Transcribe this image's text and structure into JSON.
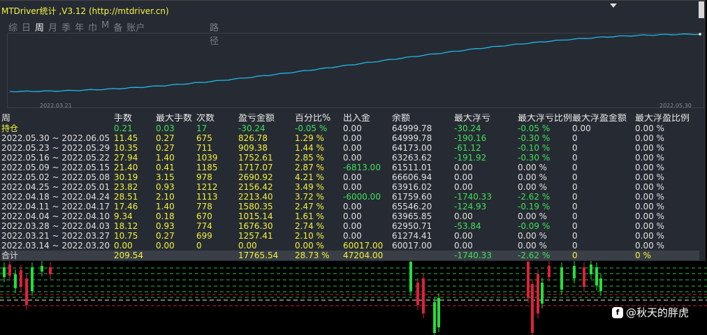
{
  "title": "MTDriver统计 ,V3.12 (http://mtdriver.cn)",
  "tabs": [
    "综",
    "日",
    "周",
    "月",
    "季",
    "年",
    "巾",
    "M",
    "备",
    "账户"
  ],
  "active_tab": "周",
  "path_tab": "路径",
  "equity": {
    "start_date": "2022.03.21",
    "end_date": "2022.05.30",
    "line_color": "#1fb8e8"
  },
  "headers": [
    "周",
    "手数",
    "最大手数",
    "次数",
    "盈亏金额",
    "百分比%",
    "出入金",
    "余额",
    "最大浮亏",
    "最大浮亏比例",
    "最大浮盈金额",
    "最大浮盈比例"
  ],
  "holding": [
    "持仓",
    "0.21",
    "0.03",
    "17",
    "-30.24",
    "-0.05 %",
    "0.00",
    "64999.78",
    "-30.24",
    "-0.05 %",
    "0.00",
    "0.00 %"
  ],
  "rows": [
    [
      "2022.05.30 ~ 2022.06.05",
      "11.45",
      "0.27",
      "675",
      "826.78",
      "1.29 %",
      "0.00",
      "64999.78",
      "-190.16",
      "-0.30 %",
      "0",
      "0.00 %"
    ],
    [
      "2022.05.23 ~ 2022.05.29",
      "10.35",
      "0.27",
      "711",
      "909.38",
      "1.44 %",
      "0.00",
      "64173.00",
      "-61.12",
      "-0.10 %",
      "0",
      "0.00 %"
    ],
    [
      "2022.05.16 ~ 2022.05.22",
      "27.94",
      "1.40",
      "1039",
      "1752.61",
      "2.85 %",
      "0.00",
      "63263.62",
      "-191.92",
      "-0.30 %",
      "0",
      "0.00 %"
    ],
    [
      "2022.05.09 ~ 2022.05.15",
      "21.40",
      "0.41",
      "1185",
      "1717.07",
      "2.87 %",
      "-6813.00",
      "61511.01",
      "0.00",
      "0.00 %",
      "0",
      "0.00 %"
    ],
    [
      "2022.05.02 ~ 2022.05.08",
      "30.19",
      "3.15",
      "978",
      "2690.92",
      "4.21 %",
      "0.00",
      "66606.94",
      "0.00",
      "0.00 %",
      "0",
      "0.00 %"
    ],
    [
      "2022.04.25 ~ 2022.05.01",
      "23.82",
      "0.93",
      "1212",
      "2156.42",
      "3.49 %",
      "0.00",
      "63916.02",
      "0.00",
      "0.00 %",
      "0",
      "0.00 %"
    ],
    [
      "2022.04.18 ~ 2022.04.24",
      "28.51",
      "2.10",
      "1113",
      "2213.40",
      "3.72 %",
      "-6000.00",
      "61759.60",
      "-1740.33",
      "-2.62 %",
      "0",
      "0.00 %"
    ],
    [
      "2022.04.11 ~ 2022.04.17",
      "17.46",
      "1.40",
      "778",
      "1580.35",
      "2.47 %",
      "0.00",
      "65546.20",
      "-124.93",
      "-0.19 %",
      "0",
      "0.00 %"
    ],
    [
      "2022.04.04 ~ 2022.04.10",
      "9.34",
      "0.18",
      "670",
      "1015.14",
      "1.61 %",
      "0.00",
      "63965.85",
      "0.00",
      "0.00 %",
      "0",
      "0.00 %"
    ],
    [
      "2022.03.28 ~ 2022.04.03",
      "18.12",
      "0.93",
      "774",
      "1676.30",
      "2.74 %",
      "0.00",
      "62950.71",
      "-53.84",
      "-0.09 %",
      "0",
      "0.00 %"
    ],
    [
      "2022.03.21 ~ 2022.03.27",
      "10.75",
      "0.27",
      "699",
      "1257.41",
      "2.10 %",
      "0.00",
      "61274.41",
      "0.00",
      "0.00 %",
      "0",
      "0.00 %"
    ],
    [
      "2022.03.14 ~ 2022.03.20",
      "0.00",
      "0.00",
      "0",
      "0.00",
      "0.00 %",
      "60017.00",
      "60017.00",
      "0.00",
      "0.00 %",
      "0",
      "0.00 %"
    ]
  ],
  "total": [
    "合计",
    "209.54",
    "",
    "",
    "17765.54",
    "28.73 %",
    "47204.00",
    "",
    "-1740.33",
    "-2.62 %",
    "0",
    "0 %"
  ],
  "watermark": "@秋天的胖虎",
  "watermark_icon": "f-badge-icon",
  "colors": {
    "panel": "#262b33",
    "yellow": "#f2f23a",
    "green": "#3fe05a",
    "bear": "#e0203a",
    "bull": "#22e03a"
  }
}
